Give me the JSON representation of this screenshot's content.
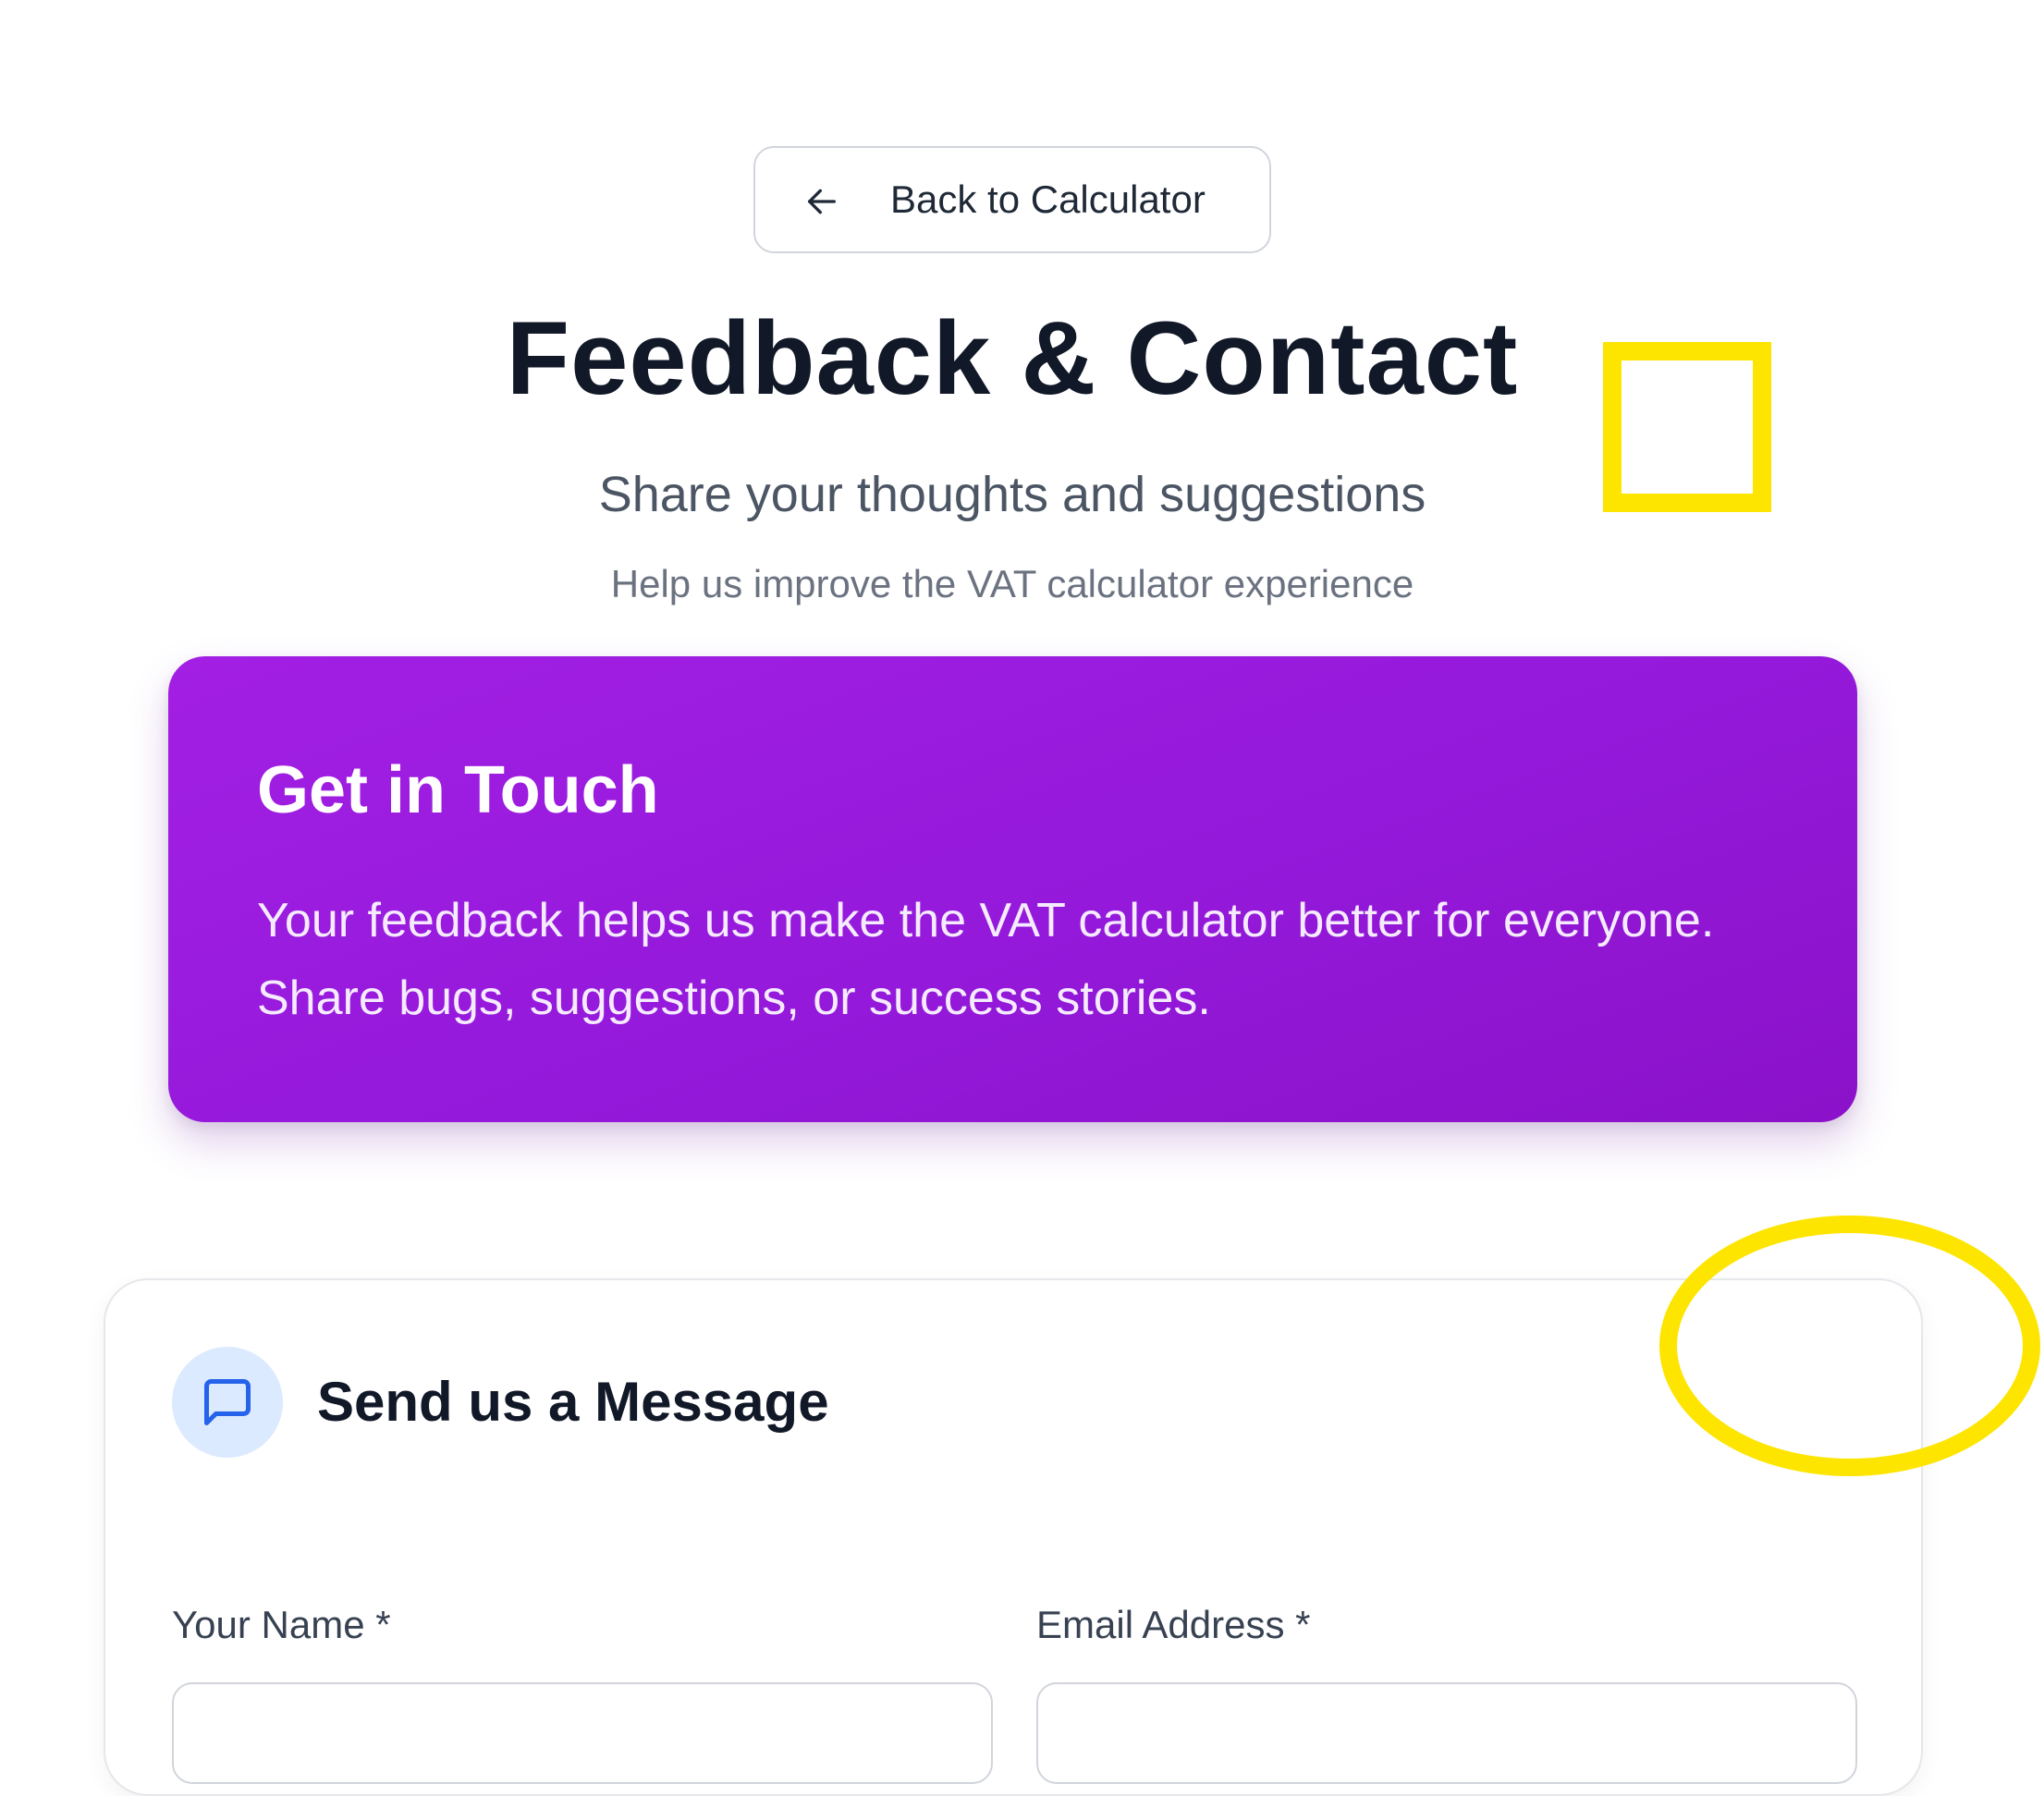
{
  "back_button": {
    "label": "Back to Calculator"
  },
  "header": {
    "title": "Feedback & Contact",
    "subtitle": "Share your thoughts and suggestions",
    "tagline": "Help us improve the VAT calculator experience"
  },
  "hero": {
    "title": "Get in Touch",
    "text": "Your feedback helps us make the VAT calculator better for everyone. Share bugs, suggestions, or success stories."
  },
  "message_form": {
    "title": "Send us a Message",
    "icon": "message-square-icon",
    "name_label": "Your Name *",
    "name_value": "",
    "email_label": "Email Address *",
    "email_value": ""
  },
  "colors": {
    "accent_purple": "#9a1de0",
    "icon_blue": "#2563eb",
    "icon_bg": "#dbeafe",
    "annotation_yellow": "#fde500"
  }
}
